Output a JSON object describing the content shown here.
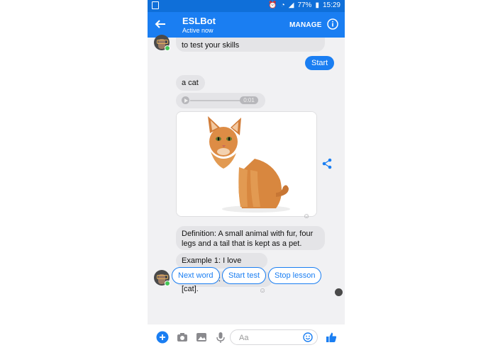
{
  "status_bar": {
    "battery_percent": "77%",
    "time": "15:29"
  },
  "header": {
    "title": "ESLBot",
    "subtitle": "Active now",
    "manage_label": "MANAGE"
  },
  "messages": {
    "m1": "to test your skills",
    "m2_sent": "Start",
    "m3": "a cat",
    "audio_time": "0:01",
    "definition": "Definition: A small animal with fur, four legs and a tail that is kept as a pet.",
    "example1": "Example 1: I love [cats]!",
    "example2": "Example 2: I have a [cat]."
  },
  "quick_replies": [
    "Next word",
    "Start test",
    "Stop lesson"
  ],
  "composer": {
    "placeholder": "Aa"
  },
  "colors": {
    "brand": "#1a7ef2",
    "online": "#43c554"
  }
}
